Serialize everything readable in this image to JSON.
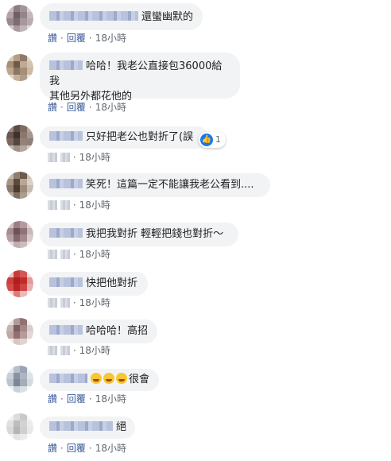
{
  "comments": [
    {
      "text": "還蠻幽默的",
      "action": "讚",
      "reply": "回覆",
      "time": "18小時"
    },
    {
      "text": "哈哈！我老公直接包36000給我",
      "text2": "其他另外都花他的",
      "action": "讚",
      "reply": "回覆",
      "time": "18小時"
    },
    {
      "text": "只好把老公也對折了(誤",
      "time": "18小時",
      "reaction_count": "1"
    },
    {
      "text": "笑死！這篇一定不能讓我老公看到....",
      "time": "18小時"
    },
    {
      "text": "我把我對折 輕輕把錢也對折～",
      "time": "18小時"
    },
    {
      "text": "快把他對折",
      "time": "18小時"
    },
    {
      "text": "哈哈哈！高招",
      "time": "18小時"
    },
    {
      "text": "很會",
      "action": "讚",
      "reply": "回覆",
      "time": "18小時"
    },
    {
      "text": "絕",
      "action": "讚",
      "reply": "回覆",
      "time": "18小時"
    }
  ],
  "colors": {
    "link": "#385898",
    "bubble": "#f2f3f5",
    "like": "#1877f2"
  },
  "icons": {
    "like": "thumbs-up-icon",
    "emoji": "rofl-emoji-icon"
  }
}
